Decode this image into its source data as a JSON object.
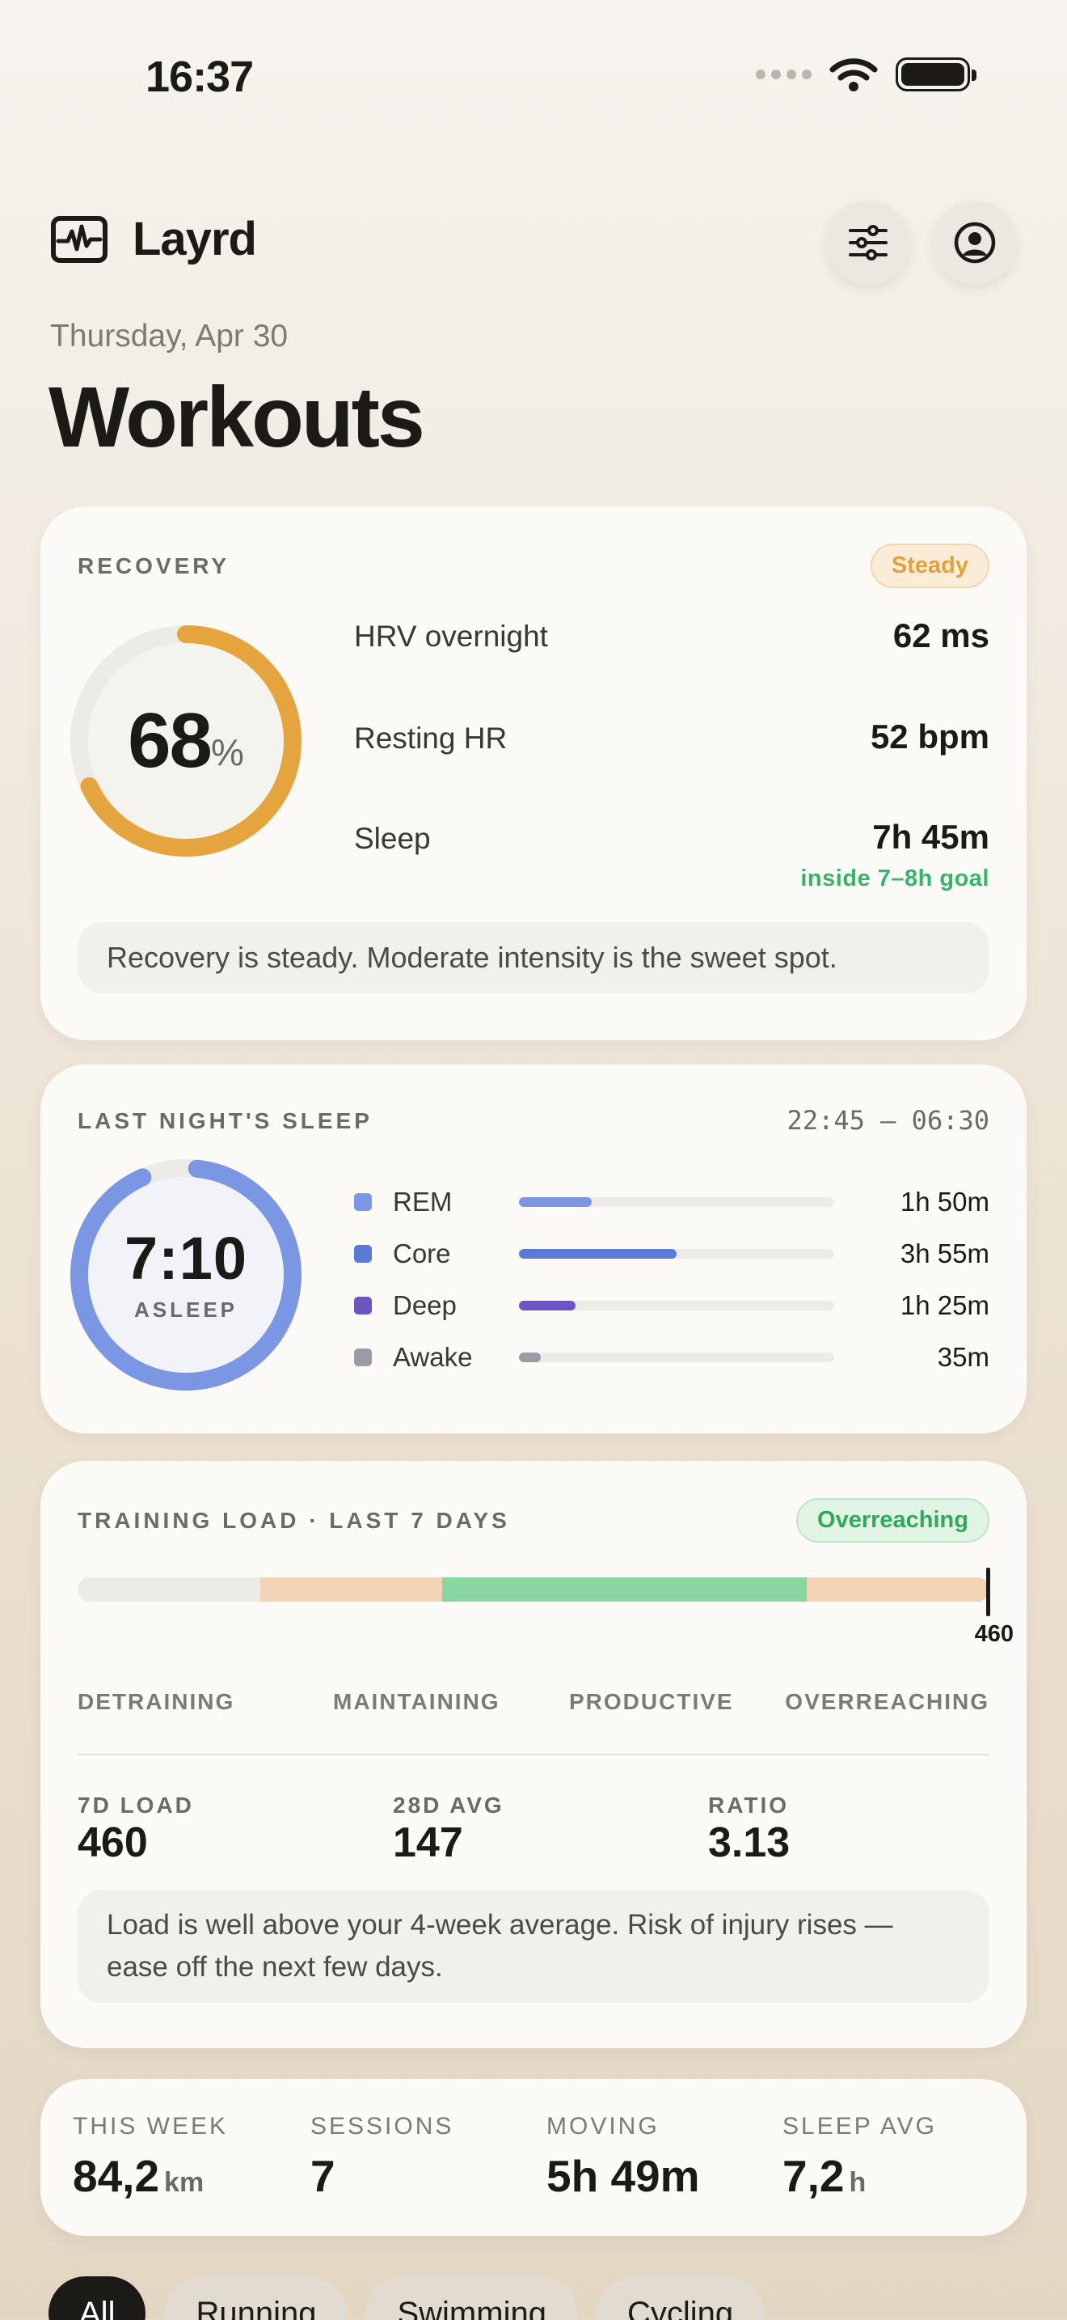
{
  "status_bar": {
    "time": "16:37"
  },
  "header": {
    "app_name": "Layrd",
    "date": "Thursday, Apr 30",
    "title": "Workouts"
  },
  "recovery": {
    "label": "RECOVERY",
    "badge": "Steady",
    "score": "68",
    "score_unit": "%",
    "score_fraction": 0.68,
    "metrics": [
      {
        "label": "HRV overnight",
        "value": "62 ms"
      },
      {
        "label": "Resting HR",
        "value": "52 bpm"
      },
      {
        "label": "Sleep",
        "value": "7h 45m",
        "note": "inside 7–8h goal"
      }
    ],
    "message": "Recovery is steady. Moderate intensity is the sweet spot."
  },
  "sleep": {
    "label": "LAST NIGHT'S SLEEP",
    "window": "22:45 — 06:30",
    "total": "7:10",
    "total_label": "ASLEEP",
    "stages": [
      {
        "name": "REM",
        "value": "1h 50m",
        "color": "#7b96e3",
        "fraction": 0.23
      },
      {
        "name": "Core",
        "value": "3h 55m",
        "color": "#5a7ad6",
        "fraction": 0.5
      },
      {
        "name": "Deep",
        "value": "1h 25m",
        "color": "#6c55c0",
        "fraction": 0.18
      },
      {
        "name": "Awake",
        "value": "35m",
        "color": "#9a9ca5",
        "fraction": 0.07
      }
    ]
  },
  "training_load": {
    "label": "TRAINING LOAD · LAST 7 DAYS",
    "badge": "Overreaching",
    "marker_value": "460",
    "zones": [
      "DETRAINING",
      "MAINTAINING",
      "PRODUCTIVE",
      "OVERREACHING"
    ],
    "stats": [
      {
        "label": "7D LOAD",
        "value": "460"
      },
      {
        "label": "28D AVG",
        "value": "147"
      },
      {
        "label": "RATIO",
        "value": "3.13"
      }
    ],
    "message": "Load is well above your 4-week average. Risk of injury rises — ease off the next few days."
  },
  "summary": [
    {
      "label": "THIS WEEK",
      "value": "84,2",
      "unit": "km"
    },
    {
      "label": "SESSIONS",
      "value": "7",
      "unit": ""
    },
    {
      "label": "MOVING",
      "value": "5h 49m",
      "unit": ""
    },
    {
      "label": "SLEEP AVG",
      "value": "7,2",
      "unit": "h"
    }
  ],
  "filters": [
    "All",
    "Running",
    "Swimming",
    "Cycling"
  ]
}
